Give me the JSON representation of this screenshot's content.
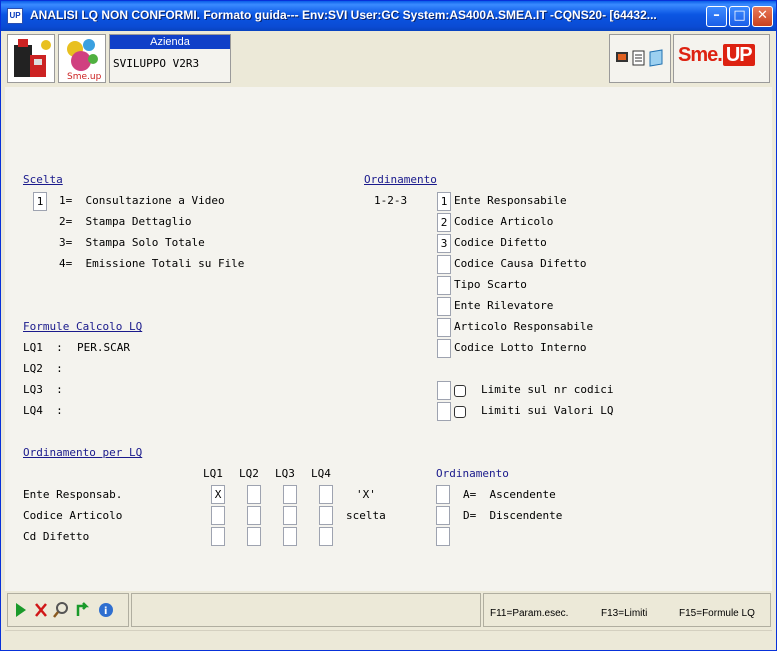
{
  "window": {
    "title": "ANALISI LQ NON CONFORMI.  Formato guida--- Env:SVI User:GC System:AS400A.SMEA.IT -CQNS20- [64432...",
    "app_icon": "UP"
  },
  "toolbar": {
    "azienda_label": "Azienda",
    "azienda_value": "SVILUPPO V2R3",
    "brand": "Sme.",
    "brand_up": "UP"
  },
  "form": {
    "scelta_header": "Scelta",
    "scelta_value": "1",
    "options": [
      "1=  Consultazione a Video",
      "2=  Stampa Dettaglio",
      "3=  Stampa Solo Totale",
      "4=  Emissione Totali su File"
    ],
    "ordinamento_header": "Ordinamento",
    "ordinamento_hint": "1-2-3",
    "ordinamento_items": [
      {
        "value": "1",
        "label": "Ente Responsabile"
      },
      {
        "value": "2",
        "label": "Codice Articolo"
      },
      {
        "value": "3",
        "label": "Codice Difetto"
      },
      {
        "value": "",
        "label": "Codice Causa Difetto"
      },
      {
        "value": "",
        "label": "Tipo Scarto"
      },
      {
        "value": "",
        "label": "Ente Rilevatore"
      },
      {
        "value": "",
        "label": "Articolo Responsabile"
      },
      {
        "value": "",
        "label": "Codice Lotto Interno"
      }
    ],
    "limiti": [
      "Limite sul nr codici",
      "Limiti sui Valori LQ"
    ],
    "formule_header": "Formule Calcolo LQ",
    "formule": [
      {
        "label": "LQ1  :",
        "value": "PER.SCAR"
      },
      {
        "label": "LQ2  :",
        "value": ""
      },
      {
        "label": "LQ3  :",
        "value": ""
      },
      {
        "label": "LQ4  :",
        "value": ""
      }
    ],
    "ord_lq_header": "Ordinamento per LQ",
    "lq_columns": [
      "LQ1",
      "LQ2",
      "LQ3",
      "LQ4"
    ],
    "lq_rows": [
      {
        "label": "Ente Responsab.",
        "values": [
          "X",
          "",
          "",
          ""
        ]
      },
      {
        "label": "Codice Articolo",
        "values": [
          "",
          "",
          "",
          ""
        ]
      },
      {
        "label": "Cd Difetto",
        "values": [
          "",
          "",
          "",
          ""
        ]
      }
    ],
    "x_hint": "'X'",
    "scelta_hint": "scelta",
    "ord2_header": "Ordinamento",
    "ord2_options": [
      "A=  Ascendente",
      "D=  Discendente"
    ]
  },
  "status": {
    "fkeys": [
      "F11=Param.esec.",
      "F13=Limiti",
      "F15=Formule LQ"
    ]
  }
}
